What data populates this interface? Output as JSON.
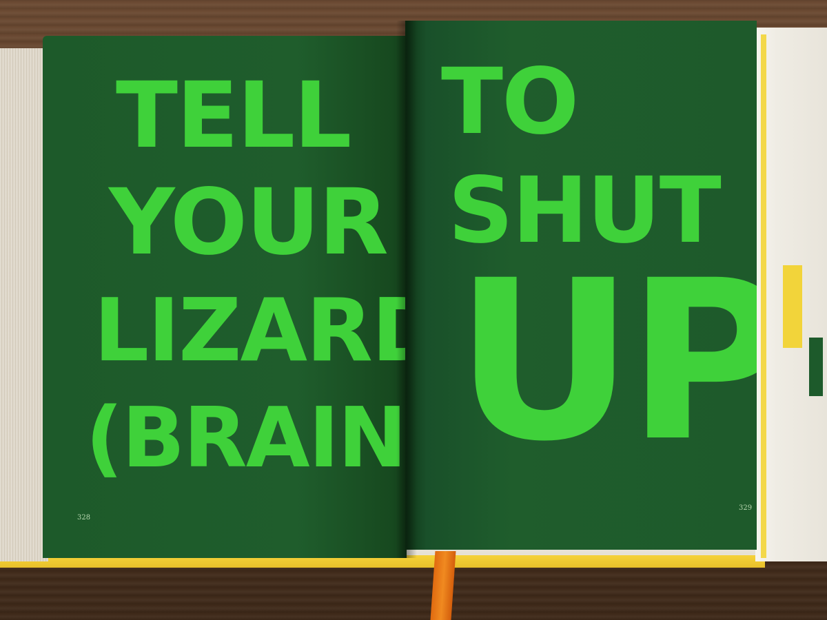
{
  "left_page": {
    "lines": [
      "TELL",
      "YOUR",
      "LIZARD",
      "(BRAIN)"
    ],
    "page_number": "328"
  },
  "right_page": {
    "lines": [
      "TO",
      "SHUT",
      "UP."
    ],
    "page_number": "329"
  },
  "colors": {
    "page_background": "#1e5a2b",
    "text": "#3fd13a",
    "cover": "#f2d43a",
    "ribbon": "#f08a20",
    "table": "#5a3a24"
  }
}
